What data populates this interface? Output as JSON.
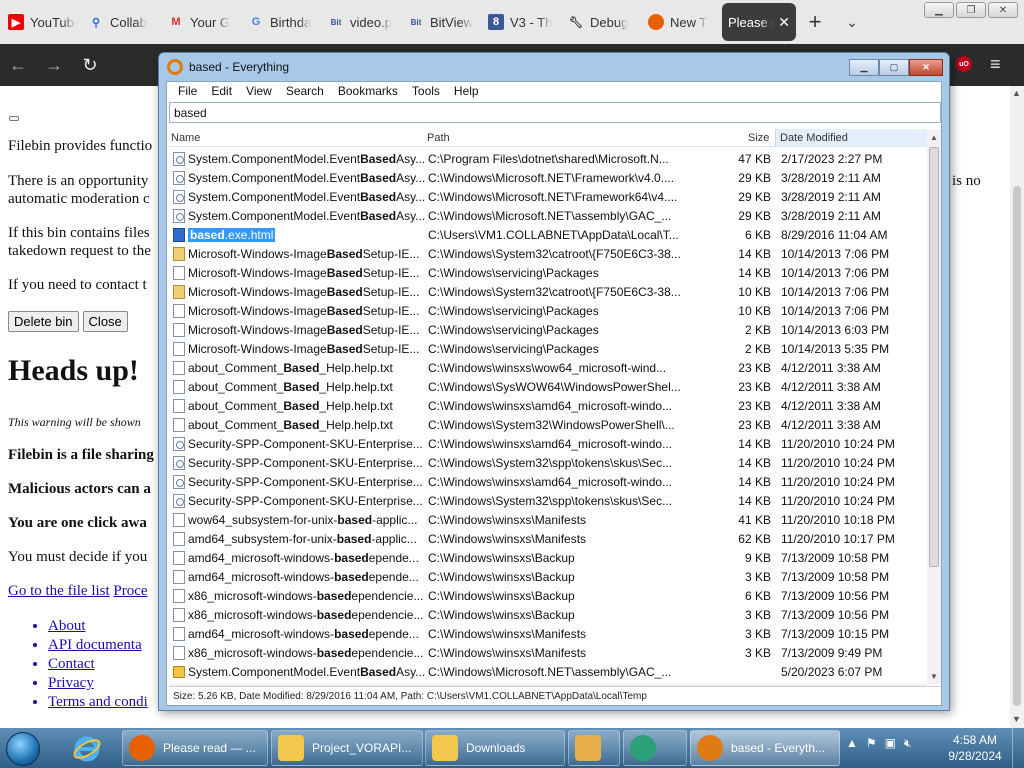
{
  "browser": {
    "tabs": [
      {
        "label": "YouTube",
        "icon": "youtube-icon"
      },
      {
        "label": "Collab",
        "icon": "search-icon"
      },
      {
        "label": "Your G",
        "icon": "gmail-icon"
      },
      {
        "label": "Birthda",
        "icon": "google-icon"
      },
      {
        "label": "video.p",
        "icon": "bitview-icon"
      },
      {
        "label": "BitView",
        "icon": "bitview-icon"
      },
      {
        "label": "V3 - Th",
        "icon": "v3-icon"
      },
      {
        "label": "Debug",
        "icon": "wrench-icon"
      },
      {
        "label": "New T",
        "icon": "firefox-icon"
      },
      {
        "label": "Please r",
        "icon": "",
        "active": true
      }
    ],
    "new_tab": "+",
    "tab_list": "⌄",
    "win_minimize": "▁",
    "win_restore": "❐",
    "win_close": "✕",
    "back": "←",
    "forward": "→",
    "reload": "↻",
    "ublock": "uO",
    "menu": "≡"
  },
  "page": {
    "p1": "Filebin provides functio",
    "p2a": "There is an opportunity",
    "p2b": "automatic moderation c",
    "p2r": "is no",
    "p3a": "If this bin contains files",
    "p3b": "takedown request to the",
    "p4": "If you need to contact t",
    "delete_btn": "Delete bin",
    "close_btn": "Close",
    "heading": "Heads up!",
    "warning": "This warning will be shown",
    "l1": "Filebin is a file sharing",
    "l2": "Malicious actors can a",
    "l3": "You are one click awa",
    "l4": "You must decide if you",
    "file_list_link": "Go to the file list",
    "proceed_link": "Proce",
    "footer_links": [
      "About",
      "API documenta",
      "Contact",
      "Privacy",
      "Terms and condi"
    ]
  },
  "everything": {
    "title": "based - Everything",
    "menu": [
      "File",
      "Edit",
      "View",
      "Search",
      "Bookmarks",
      "Tools",
      "Help"
    ],
    "search_value": "based",
    "columns": {
      "name": "Name",
      "path": "Path",
      "size": "Size",
      "date": "Date Modified"
    },
    "rows": [
      {
        "icon": "dll",
        "name_pre": "System.ComponentModel.Event",
        "name_bold": "Based",
        "name_post": "Asy...",
        "path": "C:\\Program Files\\dotnet\\shared\\Microsoft.N...",
        "size": "47 KB",
        "date": "2/17/2023 2:27 PM"
      },
      {
        "icon": "dll",
        "name_pre": "System.ComponentModel.Event",
        "name_bold": "Based",
        "name_post": "Asy...",
        "path": "C:\\Windows\\Microsoft.NET\\Framework\\v4.0....",
        "size": "29 KB",
        "date": "3/28/2019 2:11 AM"
      },
      {
        "icon": "dll",
        "name_pre": "System.ComponentModel.Event",
        "name_bold": "Based",
        "name_post": "Asy...",
        "path": "C:\\Windows\\Microsoft.NET\\Framework64\\v4....",
        "size": "29 KB",
        "date": "3/28/2019 2:11 AM"
      },
      {
        "icon": "dll",
        "name_pre": "System.ComponentModel.Event",
        "name_bold": "Based",
        "name_post": "Asy...",
        "path": "C:\\Windows\\Microsoft.NET\\assembly\\GAC_...",
        "size": "29 KB",
        "date": "3/28/2019 2:11 AM"
      },
      {
        "icon": "html",
        "name_pre": "",
        "name_bold": "based",
        "name_post": ".exe.html",
        "path": "C:\\Users\\VM1.COLLABNET\\AppData\\Local\\T...",
        "size": "6 KB",
        "date": "8/29/2016 11:04 AM",
        "selected": true
      },
      {
        "icon": "cab",
        "name_pre": "Microsoft-Windows-Image",
        "name_bold": "Based",
        "name_post": "Setup-IE...",
        "path": "C:\\Windows\\System32\\catroot\\{F750E6C3-38...",
        "size": "14 KB",
        "date": "10/14/2013 7:06 PM"
      },
      {
        "icon": "blank",
        "name_pre": "Microsoft-Windows-Image",
        "name_bold": "Based",
        "name_post": "Setup-IE...",
        "path": "C:\\Windows\\servicing\\Packages",
        "size": "14 KB",
        "date": "10/14/2013 7:06 PM"
      },
      {
        "icon": "cab",
        "name_pre": "Microsoft-Windows-Image",
        "name_bold": "Based",
        "name_post": "Setup-IE...",
        "path": "C:\\Windows\\System32\\catroot\\{F750E6C3-38...",
        "size": "10 KB",
        "date": "10/14/2013 7:06 PM"
      },
      {
        "icon": "blank",
        "name_pre": "Microsoft-Windows-Image",
        "name_bold": "Based",
        "name_post": "Setup-IE...",
        "path": "C:\\Windows\\servicing\\Packages",
        "size": "10 KB",
        "date": "10/14/2013 7:06 PM"
      },
      {
        "icon": "blank",
        "name_pre": "Microsoft-Windows-Image",
        "name_bold": "Based",
        "name_post": "Setup-IE...",
        "path": "C:\\Windows\\servicing\\Packages",
        "size": "2 KB",
        "date": "10/14/2013 6:03 PM"
      },
      {
        "icon": "blank",
        "name_pre": "Microsoft-Windows-Image",
        "name_bold": "Based",
        "name_post": "Setup-IE...",
        "path": "C:\\Windows\\servicing\\Packages",
        "size": "2 KB",
        "date": "10/14/2013 5:35 PM"
      },
      {
        "icon": "blank",
        "name_pre": "about_Comment_",
        "name_bold": "Based",
        "name_post": "_Help.help.txt",
        "path": "C:\\Windows\\winsxs\\wow64_microsoft-wind...",
        "size": "23 KB",
        "date": "4/12/2011 3:38 AM"
      },
      {
        "icon": "blank",
        "name_pre": "about_Comment_",
        "name_bold": "Based",
        "name_post": "_Help.help.txt",
        "path": "C:\\Windows\\SysWOW64\\WindowsPowerShel...",
        "size": "23 KB",
        "date": "4/12/2011 3:38 AM"
      },
      {
        "icon": "blank",
        "name_pre": "about_Comment_",
        "name_bold": "Based",
        "name_post": "_Help.help.txt",
        "path": "C:\\Windows\\winsxs\\amd64_microsoft-windo...",
        "size": "23 KB",
        "date": "4/12/2011 3:38 AM"
      },
      {
        "icon": "blank",
        "name_pre": "about_Comment_",
        "name_bold": "Based",
        "name_post": "_Help.help.txt",
        "path": "C:\\Windows\\System32\\WindowsPowerShell\\...",
        "size": "23 KB",
        "date": "4/12/2011 3:38 AM"
      },
      {
        "icon": "dll",
        "name_pre": "Security-SPP-Component-SKU-Enterprise...",
        "name_bold": "",
        "name_post": "",
        "path": "C:\\Windows\\winsxs\\amd64_microsoft-windo...",
        "size": "14 KB",
        "date": "11/20/2010 10:24 PM"
      },
      {
        "icon": "dll",
        "name_pre": "Security-SPP-Component-SKU-Enterprise...",
        "name_bold": "",
        "name_post": "",
        "path": "C:\\Windows\\System32\\spp\\tokens\\skus\\Sec...",
        "size": "14 KB",
        "date": "11/20/2010 10:24 PM"
      },
      {
        "icon": "dll",
        "name_pre": "Security-SPP-Component-SKU-Enterprise...",
        "name_bold": "",
        "name_post": "",
        "path": "C:\\Windows\\winsxs\\amd64_microsoft-windo...",
        "size": "14 KB",
        "date": "11/20/2010 10:24 PM"
      },
      {
        "icon": "dll",
        "name_pre": "Security-SPP-Component-SKU-Enterprise...",
        "name_bold": "",
        "name_post": "",
        "path": "C:\\Windows\\System32\\spp\\tokens\\skus\\Sec...",
        "size": "14 KB",
        "date": "11/20/2010 10:24 PM"
      },
      {
        "icon": "blank",
        "name_pre": "wow64_subsystem-for-unix-",
        "name_bold": "based",
        "name_post": "-applic...",
        "path": "C:\\Windows\\winsxs\\Manifests",
        "size": "41 KB",
        "date": "11/20/2010 10:18 PM"
      },
      {
        "icon": "blank",
        "name_pre": "amd64_subsystem-for-unix-",
        "name_bold": "based",
        "name_post": "-applic...",
        "path": "C:\\Windows\\winsxs\\Manifests",
        "size": "62 KB",
        "date": "11/20/2010 10:17 PM"
      },
      {
        "icon": "blank",
        "name_pre": "amd64_microsoft-windows-",
        "name_bold": "based",
        "name_post": "epende...",
        "path": "C:\\Windows\\winsxs\\Backup",
        "size": "9 KB",
        "date": "7/13/2009 10:58 PM"
      },
      {
        "icon": "blank",
        "name_pre": "amd64_microsoft-windows-",
        "name_bold": "based",
        "name_post": "epende...",
        "path": "C:\\Windows\\winsxs\\Backup",
        "size": "3 KB",
        "date": "7/13/2009 10:58 PM"
      },
      {
        "icon": "blank",
        "name_pre": "x86_microsoft-windows-",
        "name_bold": "based",
        "name_post": "ependencie...",
        "path": "C:\\Windows\\winsxs\\Backup",
        "size": "6 KB",
        "date": "7/13/2009 10:56 PM"
      },
      {
        "icon": "blank",
        "name_pre": "x86_microsoft-windows-",
        "name_bold": "based",
        "name_post": "ependencie...",
        "path": "C:\\Windows\\winsxs\\Backup",
        "size": "3 KB",
        "date": "7/13/2009 10:56 PM"
      },
      {
        "icon": "blank",
        "name_pre": "amd64_microsoft-windows-",
        "name_bold": "based",
        "name_post": "epende...",
        "path": "C:\\Windows\\winsxs\\Manifests",
        "size": "3 KB",
        "date": "7/13/2009 10:15 PM"
      },
      {
        "icon": "blank",
        "name_pre": "x86_microsoft-windows-",
        "name_bold": "based",
        "name_post": "ependencie...",
        "path": "C:\\Windows\\winsxs\\Manifests",
        "size": "3 KB",
        "date": "7/13/2009 9:49 PM"
      },
      {
        "icon": "folder",
        "name_pre": "System.ComponentModel.Event",
        "name_bold": "Based",
        "name_post": "Asy...",
        "path": "C:\\Windows\\Microsoft.NET\\assembly\\GAC_...",
        "size": "",
        "date": "5/20/2023 6:07 PM"
      }
    ],
    "status": "Size: 5.26 KB, Date Modified: 8/29/2016 11:04 AM, Path: C:\\Users\\VM1.COLLABNET\\AppData\\Local\\Temp"
  },
  "taskbar": {
    "items": [
      {
        "label": "Please read — ...",
        "icon": "firefox-icon",
        "color": "#e66000"
      },
      {
        "label": "Project_VORAPI...",
        "icon": "folder-icon",
        "color": "#f2c94c"
      },
      {
        "label": "Downloads",
        "icon": "folder-icon",
        "color": "#f2c94c"
      },
      {
        "label": "",
        "icon": "media-player-icon",
        "color": "#e8b04a"
      },
      {
        "label": "",
        "icon": "app-icon",
        "color": "#2aa178"
      },
      {
        "label": "based - Everyth...",
        "icon": "everything-icon",
        "color": "#e07a12",
        "active": true
      }
    ],
    "time": "4:58 AM",
    "date": "9/28/2024"
  }
}
